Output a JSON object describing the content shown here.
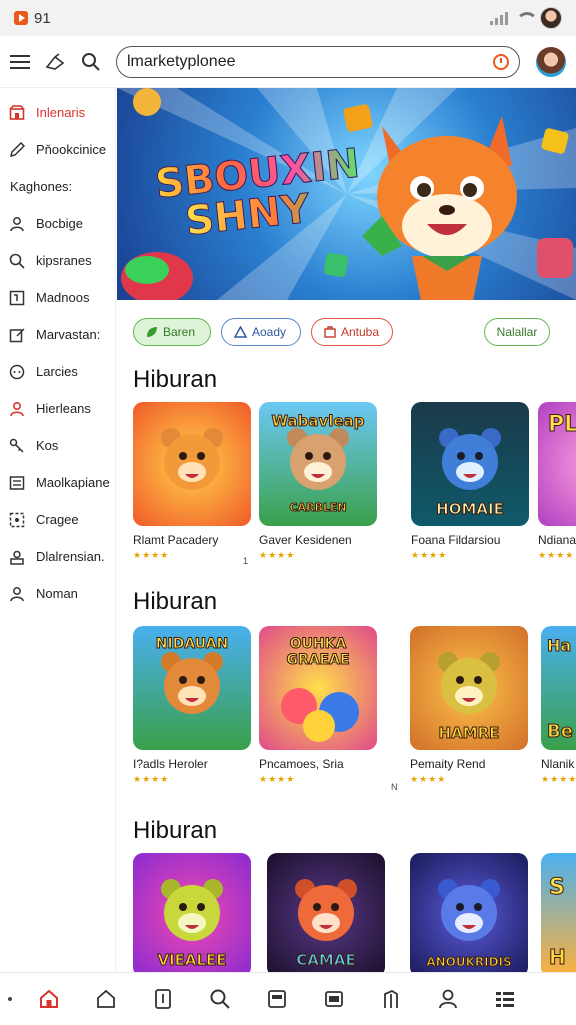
{
  "status": {
    "time": "91"
  },
  "search": {
    "value": "lmarketyplonee"
  },
  "sidebar": {
    "items": [
      {
        "label": "Inlenaris",
        "icon": "storefront-icon",
        "active": true
      },
      {
        "label": "Pňookcinice",
        "icon": "pencil-icon"
      }
    ],
    "heading": "Kaghones:",
    "items2": [
      {
        "label": "Bocbige",
        "icon": "person-icon"
      },
      {
        "label": "kipsranes",
        "icon": "search-icon"
      },
      {
        "label": "Madnoos",
        "icon": "grid-card-icon"
      },
      {
        "label": "Marvastan:",
        "icon": "edit-box-icon"
      },
      {
        "label": "Larcies",
        "icon": "dots-circle-icon"
      },
      {
        "label": "Hierleans",
        "icon": "person-red-icon"
      },
      {
        "label": "Kos",
        "icon": "key-icon"
      },
      {
        "label": "Maolkapiane",
        "icon": "list-icon"
      },
      {
        "label": "Cragee",
        "icon": "sparkle-box-icon"
      },
      {
        "label": "Dlalrensian.",
        "icon": "user-box-icon"
      },
      {
        "label": "Noman",
        "icon": "person-icon"
      }
    ]
  },
  "hero": {
    "line1": "SBOUXIN",
    "line2": "SHNY"
  },
  "chips": [
    {
      "label": "Baren",
      "style": "green"
    },
    {
      "label": "Aoady",
      "style": "blue"
    },
    {
      "label": "Antuba",
      "style": "red"
    }
  ],
  "chip_last": "Nalallar",
  "sections": [
    {
      "title": "Hiburan",
      "cards": [
        {
          "title": "Rlamt Pacadery",
          "thumb_top": "",
          "thumb_bottom": "",
          "bg": "#f0662e",
          "bear": "#f29a3a",
          "stars": "★★★★"
        },
        {
          "title": "Gaver Kesidenen",
          "thumb_top": "Wabavleap",
          "thumb_bottom": "CARBLEN",
          "bg": "#4bb0e8",
          "bear": "#d9a070",
          "stars": "★★★★"
        },
        {
          "title": "Foana Fildarsiou",
          "thumb_top": "",
          "thumb_bottom": "HOMAIE",
          "bg": "#1a5f78",
          "bear": "#3f7fd8",
          "stars": "★★★★"
        },
        {
          "title": "Ndiana",
          "thumb_top": "PL",
          "thumb_bottom": "",
          "bg": "#c04fd0",
          "bear": "#e67a2a",
          "stars": "★★★★"
        }
      ],
      "note": "1"
    },
    {
      "title": "Hiburan",
      "cards": [
        {
          "title": "I?adls Heroler",
          "thumb_top": "NIDAUAN",
          "thumb_bottom": "",
          "bg": "#3aa0e0",
          "bear": "#e38a3a",
          "stars": "★★★★"
        },
        {
          "title": "Pncamoes, Sria",
          "thumb_top": "OUHKA GRAEAE",
          "thumb_bottom": "",
          "bg": "#e0508a",
          "bear": "#ff7a4a",
          "stars": "★★★★"
        },
        {
          "title": "Pemaity Rend",
          "thumb_top": "",
          "thumb_bottom": "HAMRE",
          "bg": "#e08a2a",
          "bear": "#d9c040",
          "stars": "★★★★"
        },
        {
          "title": "Nlanik",
          "thumb_top": "Ha",
          "thumb_bottom": "Be",
          "bg": "#3aa0e0",
          "bear": "#e07a3a",
          "stars": "★★★★"
        }
      ],
      "note": "N"
    },
    {
      "title": "Hiburan",
      "cards": [
        {
          "title": "",
          "thumb_top": "",
          "thumb_bottom": "VIEALEE",
          "bg": "#a03ad0",
          "bear": "#c8d83a",
          "stars": ""
        },
        {
          "title": "",
          "thumb_top": "",
          "thumb_bottom": "CAMAE",
          "bg": "#2a1a4a",
          "bear": "#ee6a3a",
          "stars": ""
        },
        {
          "title": "",
          "thumb_top": "",
          "thumb_bottom": "ANOUKRIDIS",
          "bg": "#2a2a8a",
          "bear": "#5a7ae8",
          "stars": ""
        },
        {
          "title": "",
          "thumb_top": "S",
          "thumb_bottom": "H",
          "bg": "#3aa0e0",
          "bear": "#e0a03a",
          "stars": ""
        }
      ],
      "note": ""
    }
  ],
  "bottom_nav": [
    "dot-icon",
    "home-icon",
    "home-outline-icon",
    "document-icon",
    "search-icon",
    "calendar-icon",
    "card-icon",
    "bookmark-icon",
    "person-icon",
    "menu-grid-icon"
  ]
}
